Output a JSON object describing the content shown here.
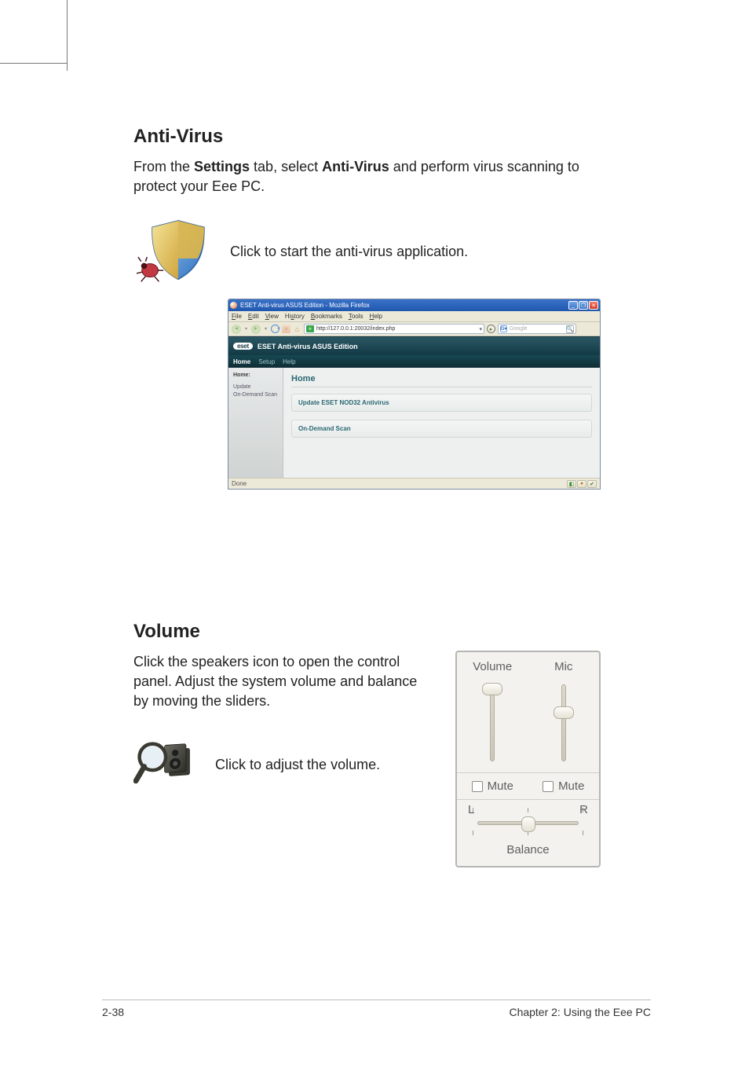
{
  "sections": {
    "antivirus": {
      "heading": "Anti-Virus",
      "body_pre": "From the ",
      "body_b1": "Settings",
      "body_mid": " tab, select ",
      "body_b2": "Anti-Virus",
      "body_post": " and perform virus scanning to protect your Eee PC.",
      "icon_desc": "Click to start the anti-virus application."
    },
    "volume": {
      "heading": "Volume",
      "body": "Click the speakers icon to open the control panel. Adjust the system volume and balance by moving the sliders.",
      "icon_desc": "Click to adjust the volume."
    }
  },
  "firefox": {
    "title": "ESET Anti-virus ASUS Edition - Mozilla Firefox",
    "menu": {
      "file": "File",
      "edit": "Edit",
      "view": "View",
      "history": "History",
      "bookmarks": "Bookmarks",
      "tools": "Tools",
      "help": "Help"
    },
    "url": "http://127.0.0.1:20032/index.php",
    "search_placeholder": "Google",
    "search_g": "G",
    "status": "Done"
  },
  "eset": {
    "logo": "eset",
    "banner": "ESET Anti-virus ASUS Edition",
    "tabs": {
      "home": "Home",
      "setup": "Setup",
      "help": "Help"
    },
    "side": {
      "hdr": "Home:",
      "update": "Update",
      "ondemand": "On-Demand Scan"
    },
    "main_heading": "Home",
    "panel1": "Update ESET NOD32 Antivirus",
    "panel2": "On-Demand Scan"
  },
  "volpanel": {
    "volume_label": "Volume",
    "mic_label": "Mic",
    "mute": "Mute",
    "L": "L",
    "R": "R",
    "balance": "Balance"
  },
  "footer": {
    "page": "2-38",
    "chapter": "Chapter 2: Using the Eee PC"
  }
}
